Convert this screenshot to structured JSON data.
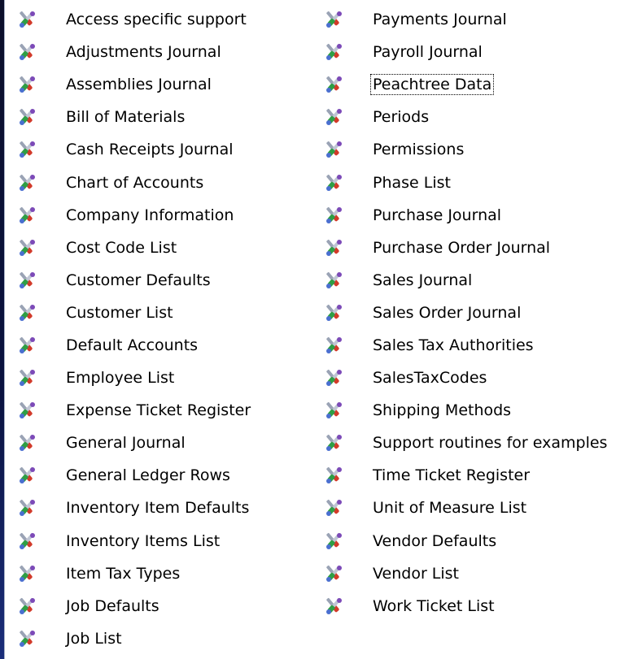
{
  "list": {
    "left_items": [
      {
        "label": "Access specific support"
      },
      {
        "label": "Adjustments Journal"
      },
      {
        "label": "Assemblies Journal"
      },
      {
        "label": "Bill of Materials"
      },
      {
        "label": "Cash Receipts Journal"
      },
      {
        "label": "Chart of Accounts"
      },
      {
        "label": "Company Information"
      },
      {
        "label": "Cost Code List"
      },
      {
        "label": "Customer Defaults"
      },
      {
        "label": "Customer List"
      },
      {
        "label": "Default Accounts"
      },
      {
        "label": "Employee List"
      },
      {
        "label": "Expense Ticket Register"
      },
      {
        "label": "General Journal"
      },
      {
        "label": "General Ledger Rows"
      },
      {
        "label": "Inventory Item Defaults"
      },
      {
        "label": "Inventory Items List"
      },
      {
        "label": "Item Tax Types"
      },
      {
        "label": "Job Defaults"
      },
      {
        "label": "Job List"
      }
    ],
    "right_items": [
      {
        "label": "Payments Journal"
      },
      {
        "label": "Payroll Journal"
      },
      {
        "label": "Peachtree Data",
        "focused": true
      },
      {
        "label": "Periods"
      },
      {
        "label": "Permissions"
      },
      {
        "label": "Phase List"
      },
      {
        "label": "Purchase Journal"
      },
      {
        "label": "Purchase Order Journal"
      },
      {
        "label": "Sales Journal"
      },
      {
        "label": "Sales Order Journal"
      },
      {
        "label": "Sales Tax Authorities"
      },
      {
        "label": "SalesTaxCodes"
      },
      {
        "label": "Shipping Methods"
      },
      {
        "label": "Support routines for examples"
      },
      {
        "label": "Time Ticket Register"
      },
      {
        "label": "Unit of Measure List"
      },
      {
        "label": "Vendor Defaults"
      },
      {
        "label": "Vendor List"
      },
      {
        "label": "Work Ticket List"
      }
    ],
    "item_icon": "tools-icon",
    "colors": {
      "background": "#ffffff",
      "desktop": "#0b1030"
    }
  }
}
